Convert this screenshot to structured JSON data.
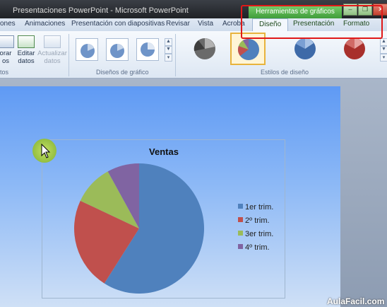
{
  "window": {
    "title": "Presentaciones PowerPoint - Microsoft PowerPoint"
  },
  "context_tab_header": "Herramientas de gráficos",
  "tabs": [
    {
      "label": "ones"
    },
    {
      "label": "Animaciones"
    },
    {
      "label": "Presentación con diapositivas"
    },
    {
      "label": "Revisar"
    },
    {
      "label": "Vista"
    },
    {
      "label": "Acroba"
    },
    {
      "label": "Diseño",
      "active": true
    },
    {
      "label": "Presentación"
    },
    {
      "label": "Formato"
    }
  ],
  "ribbon": {
    "data_group": {
      "label": "tos",
      "buttons": [
        {
          "label": "orar\nos"
        },
        {
          "label": "Editar\ndatos"
        },
        {
          "label": "Actualizar\ndatos",
          "disabled": true
        }
      ]
    },
    "chart_layouts_label": "Diseños de gráfico",
    "chart_styles_label": "Estilos de diseño"
  },
  "chart_data": {
    "type": "pie",
    "title": "Ventas",
    "categories": [
      "1er trim.",
      "2º trim.",
      "3er trim.",
      "4º trim."
    ],
    "values": [
      59,
      23,
      10,
      8
    ],
    "colors": [
      "#4f81bd",
      "#c0504d",
      "#9bbb59",
      "#8064a2"
    ],
    "legend": "right"
  },
  "watermark": "AulaFacil.com"
}
